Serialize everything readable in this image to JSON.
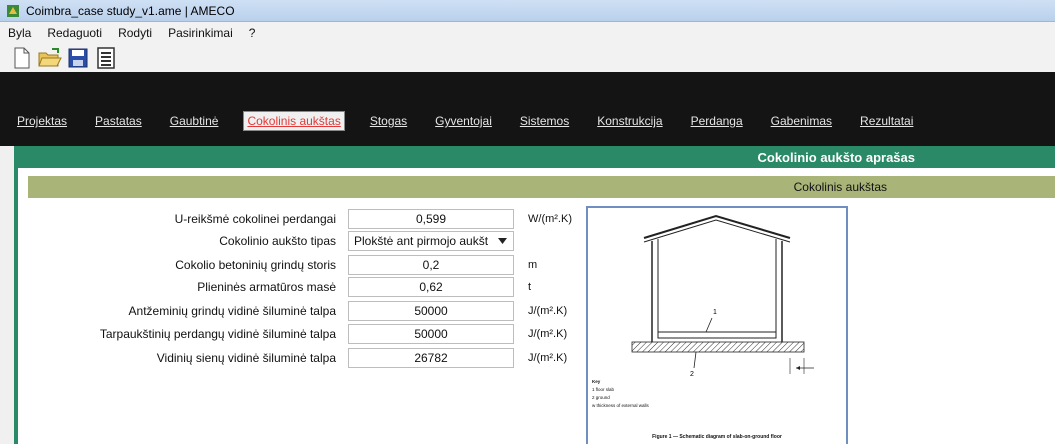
{
  "window": {
    "title": "Coimbra_case study_v1.ame | AMECO"
  },
  "menu": {
    "items": [
      "Byla",
      "Redaguoti",
      "Rodyti",
      "Pasirinkimai",
      "?"
    ]
  },
  "toolbar": {
    "icons": [
      "new-file-icon",
      "open-folder-icon",
      "save-icon",
      "document-icon"
    ]
  },
  "tabs": [
    {
      "label": "Projektas",
      "active": false
    },
    {
      "label": "Pastatas",
      "active": false
    },
    {
      "label": "Gaubtinė",
      "active": false
    },
    {
      "label": "Cokolinis aukštas",
      "active": true
    },
    {
      "label": "Stogas",
      "active": false
    },
    {
      "label": "Gyventojai",
      "active": false
    },
    {
      "label": "Sistemos",
      "active": false
    },
    {
      "label": "Konstrukcija",
      "active": false
    },
    {
      "label": "Perdanga",
      "active": false
    },
    {
      "label": "Gabenimas",
      "active": false
    },
    {
      "label": "Rezultatai",
      "active": false
    }
  ],
  "panel": {
    "header": "Cokolinio aukšto aprašas",
    "section": "Cokolinis aukštas"
  },
  "fields": [
    {
      "label": "U-reikšmė cokolinei perdangai",
      "value": "0,599",
      "unit": "W/(m².K)",
      "type": "input"
    },
    {
      "label": "Cokolinio aukšto tipas",
      "value": "Plokštė ant pirmojo aukšt",
      "unit": "",
      "type": "select"
    },
    {
      "label": "Cokolio betoninių grindų storis",
      "value": "0,2",
      "unit": "m",
      "type": "input"
    },
    {
      "label": "Plieninės armatūros masė",
      "value": "0,62",
      "unit": "t",
      "type": "input"
    },
    {
      "label": "Antžeminių grindų vidinė šiluminė talpa",
      "value": "50000",
      "unit": "J/(m².K)",
      "type": "input"
    },
    {
      "label": "Tarpaukštinių perdangų vidinė šiluminė talpa",
      "value": "50000",
      "unit": "J/(m².K)",
      "type": "input"
    },
    {
      "label": "Vidinių sienų vidinė šiluminė talpa",
      "value": "26782",
      "unit": "J/(m².K)",
      "type": "input"
    }
  ],
  "figure": {
    "callout_1": "1",
    "callout_2": "2",
    "key_title": "Key",
    "key_1": "1   floor slab",
    "key_2": "2   ground",
    "key_w": "w   thickness of external walls",
    "caption": "Figure 1 — Schematic diagram of slab-on-ground floor"
  },
  "colors": {
    "accent_tab": "#e23a3a",
    "panel_green": "#2a8a68",
    "section_olive": "#a8b478",
    "tabbar_bg": "#141414"
  }
}
